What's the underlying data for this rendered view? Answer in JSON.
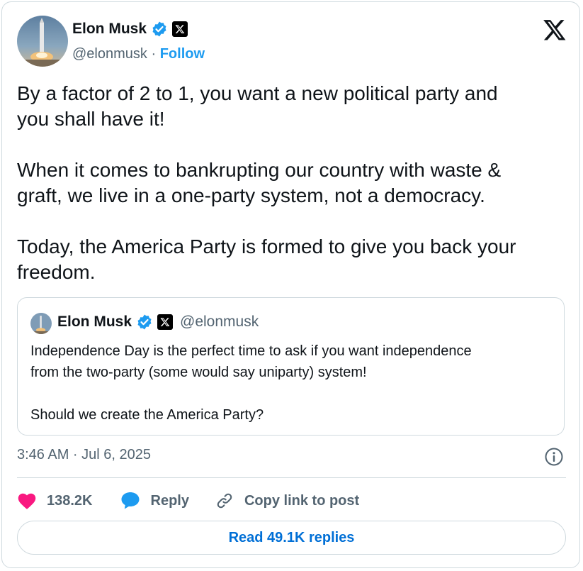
{
  "post": {
    "author_name": "Elon Musk",
    "handle": "@elonmusk",
    "separator": "·",
    "follow_label": "Follow",
    "text": "By a factor of 2 to 1, you want a new political party and\nyou shall have it!\n\nWhen it comes to bankrupting our country with waste &\ngraft, we live in a one-party system, not a democracy.\n\nToday, the America Party is formed to give you back your\nfreedom.",
    "timestamp": "3:46 AM · Jul 6, 2025"
  },
  "quoted_post": {
    "author_name": "Elon Musk",
    "handle": "@elonmusk",
    "text": "Independence Day is the perfect time to ask if you want independence\nfrom the two-party (some would say uniparty) system!\n\nShould we create the America Party?"
  },
  "actions": {
    "like_count": "138.2K",
    "reply_label": "Reply",
    "copy_link_label": "Copy link to post"
  },
  "read_replies_label": "Read 49.1K replies",
  "icons": {
    "verified": "verified-badge-icon",
    "affiliate": "x-affiliate-icon",
    "brand": "x-logo-icon",
    "info": "info-icon",
    "like": "heart-icon",
    "reply": "speech-bubble-icon",
    "link": "link-icon"
  },
  "colors": {
    "accent": "#1d9bf0",
    "like": "#f91880",
    "secondary_text": "#536471",
    "border": "#cfd9de",
    "read_replies": "#006fd6"
  }
}
